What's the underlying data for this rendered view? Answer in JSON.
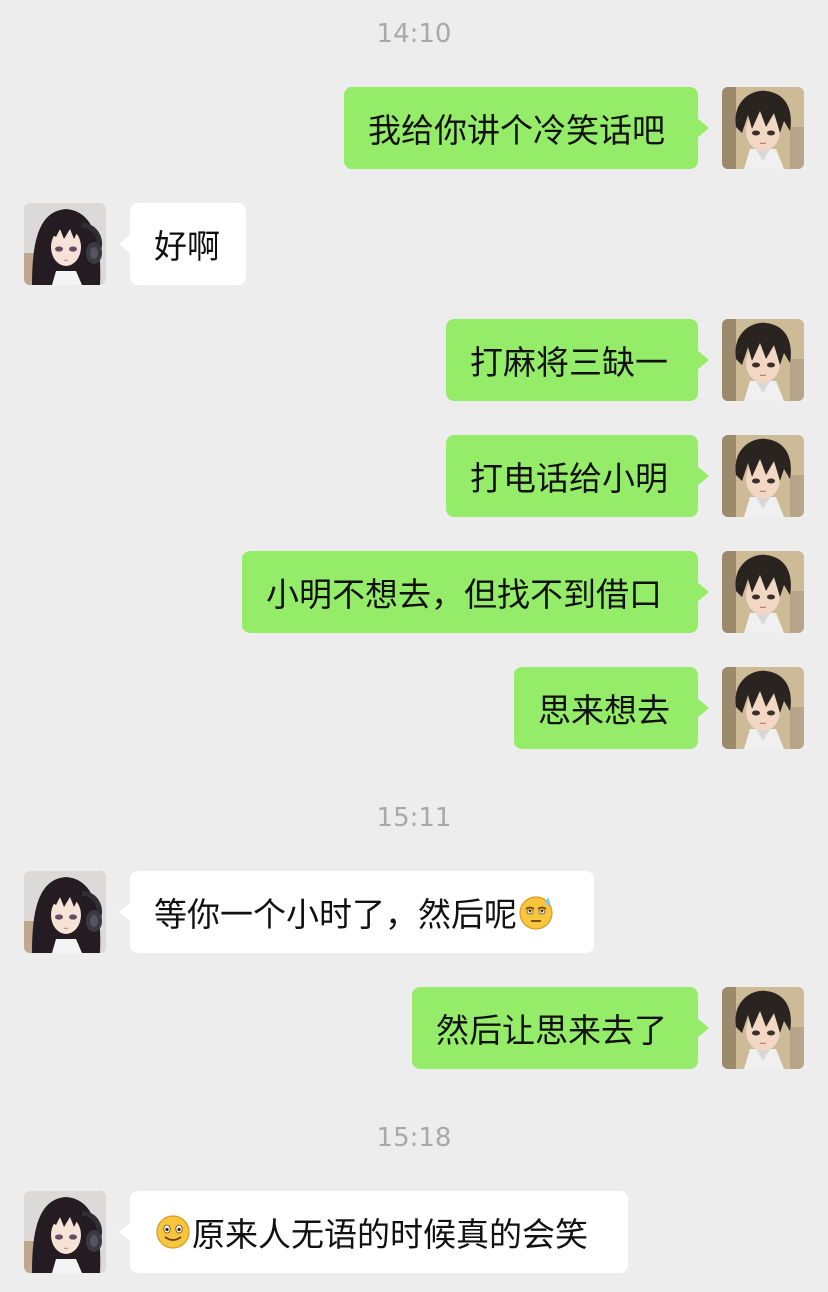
{
  "timestamps": [
    "14:10",
    "15:11",
    "15:18"
  ],
  "messages": [
    {
      "sender": "me",
      "text": "我给你讲个冷笑话吧"
    },
    {
      "sender": "friend",
      "text": "好啊"
    },
    {
      "sender": "me",
      "text": "打麻将三缺一"
    },
    {
      "sender": "me",
      "text": "打电话给小明"
    },
    {
      "sender": "me",
      "text": "小明不想去，但找不到借口"
    },
    {
      "sender": "me",
      "text": "思来想去"
    },
    {
      "sender": "friend",
      "text": "等你一个小时了，然后呢",
      "emoji": "sweat-roll-eyes-emoji"
    },
    {
      "sender": "me",
      "text": "然后让思来去了"
    },
    {
      "sender": "friend",
      "text": "原来人无语的时候真的会笑",
      "emoji": "smile-emoji"
    }
  ],
  "colors": {
    "background": "#ededed",
    "sent_bubble": "#95ec69",
    "received_bubble": "#ffffff",
    "timestamp_text": "#a8a8a8"
  },
  "avatars": {
    "me": "anime-boy-avatar",
    "friend": "anime-girl-headphones-avatar"
  }
}
